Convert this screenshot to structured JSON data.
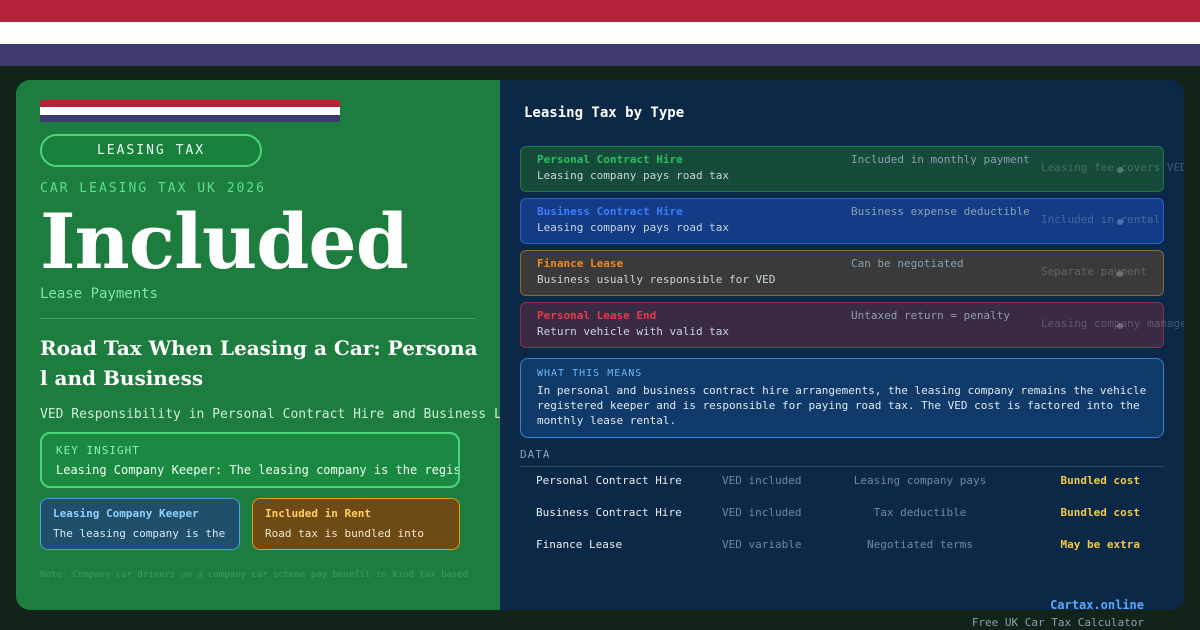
{
  "colors": {
    "flag_red": "#b4233a",
    "flag_white": "#ffffff",
    "flag_blue": "#3d3a6e",
    "left_panel": "#1d7d3e",
    "right_panel": "#0c2847",
    "accent_green": "#4bd67c",
    "accent_gold": "#f5c842"
  },
  "left": {
    "pill": "LEASING TAX",
    "subtitle": "CAR LEASING TAX UK 2026",
    "hero": "Included",
    "hero_sub": "Lease Payments",
    "headline": "Road Tax When Leasing a Car: Personal and Business",
    "ved_line": "VED Responsibility in Personal Contract Hire and Business Lea",
    "insight": {
      "label": "KEY INSIGHT",
      "text": "Leasing Company Keeper: The leasing company is the registered k"
    },
    "box_a": {
      "label": "Leasing Company Keeper",
      "text": "The leasing company is the"
    },
    "box_b": {
      "label": "Included in Rent",
      "text": "Road tax is bundled into"
    },
    "note": "Note: Company car drivers on a company car scheme pay benefit in kind tax based"
  },
  "right": {
    "title": "Leasing Tax by Type",
    "rows": [
      {
        "name": "Personal Contract Hire",
        "desc": "Leasing company pays road tax",
        "note": "Included in monthly payment",
        "ghost": "Leasing fee covers VED"
      },
      {
        "name": "Business Contract Hire",
        "desc": "Leasing company pays road tax",
        "note": "Business expense deductible",
        "ghost": "Included in rental"
      },
      {
        "name": "Finance Lease",
        "desc": "Business usually responsible for VED",
        "note": "Can be negotiated",
        "ghost": "Separate payment"
      },
      {
        "name": "Personal Lease End",
        "desc": "Return vehicle with valid tax",
        "note": "Untaxed return = penalty",
        "ghost": "Leasing company manages"
      }
    ],
    "means": {
      "label": "WHAT THIS MEANS",
      "text": "In personal and business contract hire arrangements, the leasing company remains the vehicle registered keeper and is responsible for paying road tax. The VED cost is factored into the monthly lease rental."
    },
    "data_label": "DATA",
    "data_rows": [
      {
        "type": "Personal Contract Hire",
        "ved": "VED included",
        "who": "Leasing company pays",
        "cost": "Bundled cost"
      },
      {
        "type": "Business Contract Hire",
        "ved": "VED included",
        "who": "Tax deductible",
        "cost": "Bundled cost"
      },
      {
        "type": "Finance Lease",
        "ved": "VED variable",
        "who": "Negotiated terms",
        "cost": "May be extra"
      }
    ],
    "brand": "Cartax.online",
    "brand_sub": "Free UK Car Tax Calculator"
  }
}
